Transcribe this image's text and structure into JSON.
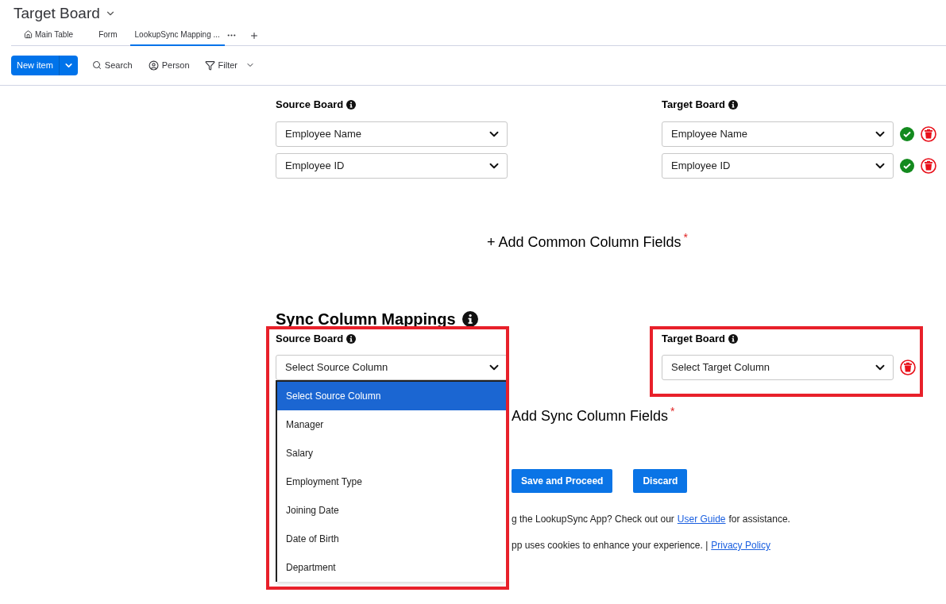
{
  "board": {
    "title": "Target Board"
  },
  "tabs": [
    {
      "label": "Main Table",
      "kind": "home",
      "selected": false
    },
    {
      "label": "Form",
      "kind": "plain",
      "selected": false
    },
    {
      "label": "LookupSync Mapping ...",
      "kind": "plain",
      "selected": true
    }
  ],
  "toolbar": {
    "new_item": "New item",
    "search": "Search",
    "person": "Person",
    "filter": "Filter"
  },
  "common": {
    "source_label": "Source Board",
    "target_label": "Target Board",
    "rows": [
      {
        "source": "Employee Name",
        "target": "Employee Name",
        "matched": true
      },
      {
        "source": "Employee ID",
        "target": "Employee ID",
        "matched": true
      }
    ],
    "add": "+ Add Common Column Fields",
    "required_mark": "*"
  },
  "sync": {
    "heading": "Sync Column Mappings",
    "source_label": "Source Board",
    "target_label": "Target Board",
    "source_select": "Select Source Column",
    "target_select": "Select Target Column",
    "matched": false,
    "options": [
      {
        "label": "Select Source Column",
        "selected": true
      },
      {
        "label": "Manager",
        "selected": false
      },
      {
        "label": "Salary",
        "selected": false
      },
      {
        "label": "Employment Type",
        "selected": false
      },
      {
        "label": "Joining Date",
        "selected": false
      },
      {
        "label": "Date of Birth",
        "selected": false
      },
      {
        "label": "Department",
        "selected": false
      }
    ],
    "add": "Add Sync Column Fields",
    "required_mark": "*"
  },
  "buttons": [
    "Save and Proceed",
    "Discard"
  ],
  "footer": {
    "help_text": "g the LookupSync App? Check out our",
    "guide_link": "User Guide",
    "help_end": "for assistance.",
    "cookie_text": "pp uses cookies to enhance your experience. |",
    "privacy_link": "Privacy Policy"
  }
}
